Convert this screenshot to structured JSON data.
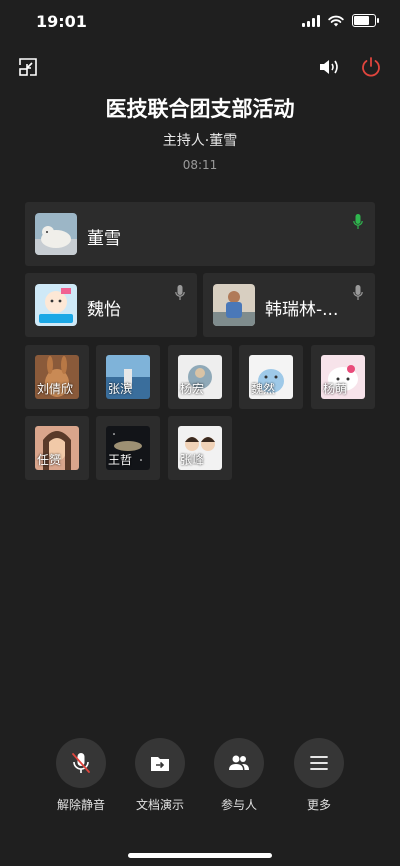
{
  "status_bar": {
    "time": "19:01",
    "battery_fraction": 0.9
  },
  "meeting": {
    "title": "医技联合团支部活动",
    "host": "主持人·董雪",
    "duration": "08:11"
  },
  "speaker": {
    "name": "董雪",
    "mic_state": "active",
    "mic_color": "#2fb64e"
  },
  "participants_mid": [
    {
      "name": "魏怡",
      "mic_state": "idle"
    },
    {
      "name": "韩瑞林-...",
      "mic_state": "idle"
    }
  ],
  "participants_small": [
    {
      "name": "刘倩欣"
    },
    {
      "name": "张滨"
    },
    {
      "name": "杨宏"
    },
    {
      "name": "魏然"
    },
    {
      "name": "杨萌"
    },
    {
      "name": "任赟"
    },
    {
      "name": "王哲"
    },
    {
      "name": "张峰"
    }
  ],
  "controls": [
    {
      "label": "解除静音",
      "icon": "muted-mic-icon"
    },
    {
      "label": "文档演示",
      "icon": "share-doc-icon"
    },
    {
      "label": "参与人",
      "icon": "participants-icon"
    },
    {
      "label": "更多",
      "icon": "more-menu-icon"
    }
  ],
  "colors": {
    "background": "#1f1f1f",
    "tile": "#2c2c2c",
    "end_button": "#e0453d",
    "muted_slash": "#e0453d"
  }
}
